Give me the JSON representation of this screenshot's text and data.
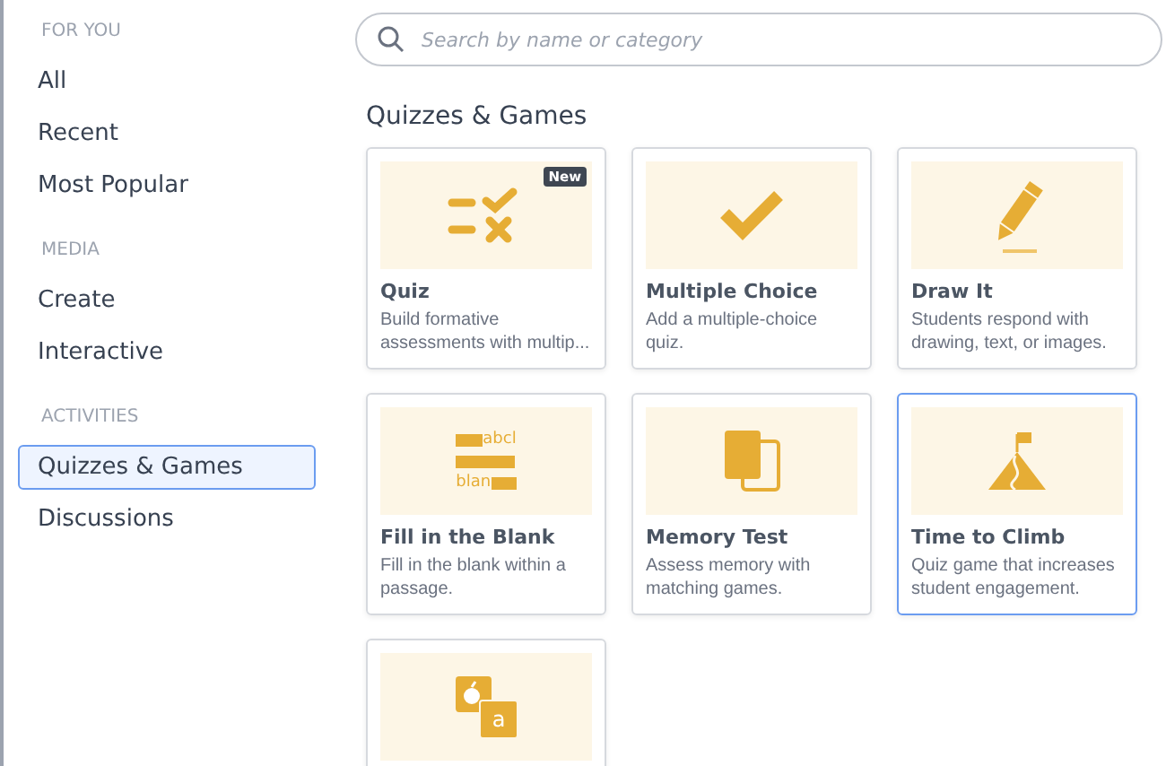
{
  "sidebar": {
    "sections": [
      {
        "heading": "FOR YOU",
        "items": [
          {
            "label": "All",
            "selected": false
          },
          {
            "label": "Recent",
            "selected": false
          },
          {
            "label": "Most Popular",
            "selected": false
          }
        ]
      },
      {
        "heading": "MEDIA",
        "items": [
          {
            "label": "Create",
            "selected": false
          },
          {
            "label": "Interactive",
            "selected": false
          }
        ]
      },
      {
        "heading": "ACTIVITIES",
        "items": [
          {
            "label": "Quizzes & Games",
            "selected": true
          },
          {
            "label": "Discussions",
            "selected": false
          }
        ]
      }
    ]
  },
  "search": {
    "placeholder": "Search by name or category"
  },
  "section_title": "Quizzes & Games",
  "cards": [
    {
      "kind": "quiz",
      "title": "Quiz",
      "description": "Build formative assessments with multip...",
      "badge": "New",
      "selected": false
    },
    {
      "kind": "check",
      "title": "Multiple Choice",
      "description": "Add a multiple-choice quiz.",
      "selected": false
    },
    {
      "kind": "pencil",
      "title": "Draw It",
      "description": "Students respond with drawing, text, or images.",
      "selected": false
    },
    {
      "kind": "fill",
      "title": "Fill in the Blank",
      "description": "Fill in the blank within a passage.",
      "icon_text": [
        "abcl",
        "blan"
      ],
      "selected": false
    },
    {
      "kind": "memory",
      "title": "Memory Test",
      "description": "Assess memory with matching games.",
      "selected": false
    },
    {
      "kind": "climb",
      "title": "Time to Climb",
      "description": "Quiz game that increases student engagement.",
      "selected": true
    },
    {
      "kind": "flashcard",
      "icon_text": [
        "a"
      ],
      "selected": false
    }
  ]
}
